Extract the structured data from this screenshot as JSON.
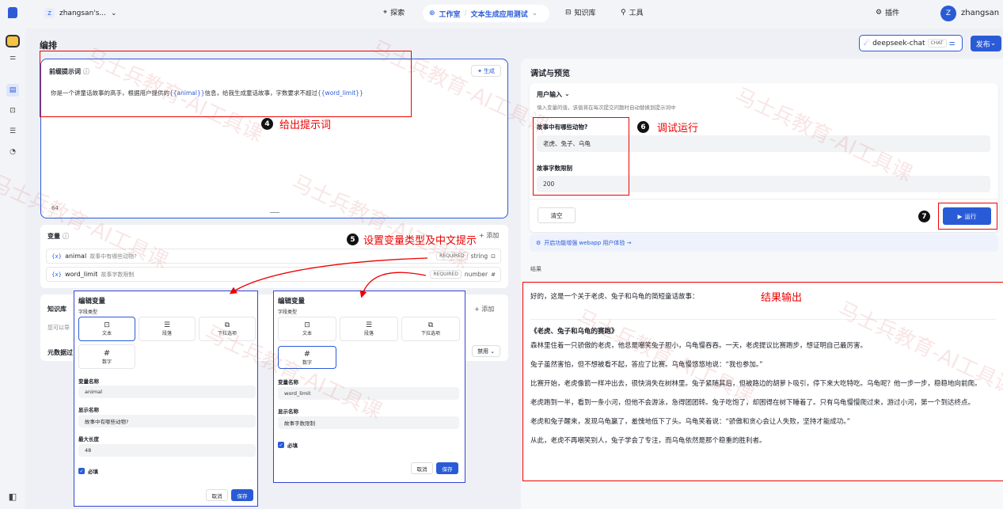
{
  "topbar": {
    "workspace": "zhangsan's...",
    "nav_explore": "探索",
    "nav_studio": "工作室",
    "app_name": "文本生成应用测试",
    "nav_knowledge": "知识库",
    "nav_tools": "工具",
    "plugins": "插件",
    "avatar_letter": "Z",
    "username": "zhangsan"
  },
  "header": {
    "title": "编排",
    "model_name": "deepseek-chat",
    "model_badge": "CHAT",
    "publish": "发布"
  },
  "prompt": {
    "title": "前缀提示词",
    "generate": "生成",
    "text_prefix": "你是一个讲童话故事的高手，根据用户提供的",
    "var1": "{{animal}}",
    "text_mid": "信息，给我生成童话故事，字数要求不超过",
    "var2": "{{word_limit}}",
    "char_count": "64"
  },
  "annotations": {
    "a4_num": "4",
    "a4": "给出提示词",
    "a5_num": "5",
    "a5": "设置变量类型及中文提示",
    "a6_num": "6",
    "a6": "调试运行",
    "a7_num": "7",
    "result": "结果输出"
  },
  "variables": {
    "title": "变量",
    "add": "添加",
    "items": [
      {
        "name": "animal",
        "label": "故事中有哪些动物?",
        "required": "REQUIRED",
        "type": "string"
      },
      {
        "name": "word_limit",
        "label": "故事字数限制",
        "required": "REQUIRED",
        "type": "number"
      }
    ]
  },
  "knowledge": {
    "title": "知识库",
    "add": "添加",
    "desc": "您可以导",
    "meta": "元数据过",
    "disable": "禁用"
  },
  "dialog1": {
    "title": "编辑变量",
    "field_type": "字段类型",
    "types": [
      "文本",
      "段落",
      "下拉选项",
      "数字"
    ],
    "var_name_label": "变量名称",
    "var_name": "animal",
    "display_label": "显示名称",
    "display": "故事中有哪些动物?",
    "maxlen_label": "最大长度",
    "maxlen": "48",
    "required": "必填",
    "cancel": "取消",
    "save": "保存"
  },
  "dialog2": {
    "title": "编辑变量",
    "field_type": "字段类型",
    "types": [
      "文本",
      "段落",
      "下拉选项",
      "数字"
    ],
    "var_name_label": "变量名称",
    "var_name": "word_limit",
    "display_label": "显示名称",
    "display": "故事字数限制",
    "required": "必填",
    "cancel": "取消",
    "save": "保存"
  },
  "debug": {
    "title": "调试与预览",
    "user_input": "用户输入",
    "hint": "填入变量的值，该值将在每次提交问题时自动替换到提示词中",
    "q1": "故事中有哪些动物?",
    "a1": "老虎、兔子、乌龟",
    "q2": "故事字数限制",
    "a2": "200",
    "clear": "清空",
    "run": "运行",
    "enhance": "开启功能增强 webapp 用户体验 →",
    "result_label": "结果"
  },
  "result": {
    "intro": "好的，这是一个关于老虎、兔子和乌龟的简短童话故事：",
    "title": "《老虎、兔子和乌龟的赛跑》",
    "paragraphs": [
      "森林里住着一只骄傲的老虎，他总是嘲笑兔子胆小，乌龟慢吞吞。一天，老虎提议比赛跑步，想证明自己最厉害。",
      "兔子虽然害怕，但不想被看不起，答应了比赛。乌龟慢悠悠地说：“我也参加。”",
      "比赛开始，老虎像箭一样冲出去，很快消失在树林里。兔子紧随其后，但被路边的胡萝卜吸引，停下来大吃特吃。乌龟呢？他一步一步，稳稳地向前爬。",
      "老虎跑到一半，看到一条小河，但他不会游泳，急得团团转。兔子吃饱了，却困得在树下睡着了。只有乌龟慢慢爬过来，游过小河，第一个到达终点。",
      "老虎和兔子醒来，发现乌龟赢了，羞愧地低下了头。乌龟笑着说：“骄傲和贪心会让人失败，坚持才能成功。”",
      "从此，老虎不再嘲笑别人，兔子学会了专注，而乌龟依然是那个稳重的胜利者。"
    ]
  },
  "watermark": "马士兵教育-AI工具课"
}
